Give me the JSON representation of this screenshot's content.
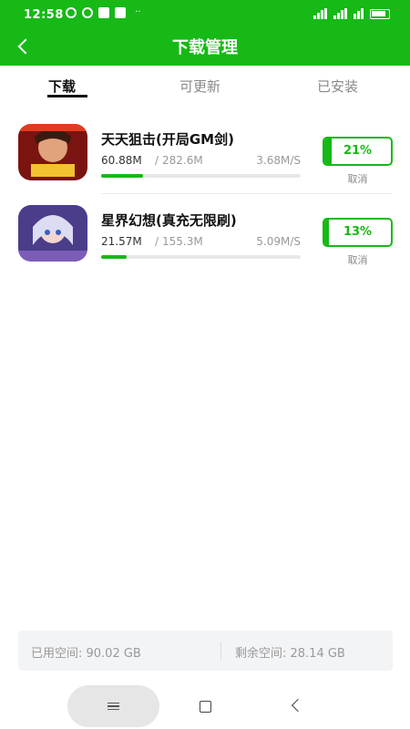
{
  "status": {
    "time": "12:58",
    "dots": "··"
  },
  "header": {
    "title": "下载管理",
    "back_icon": "chevron-left-icon"
  },
  "tabs": [
    {
      "label": "下载",
      "active": true
    },
    {
      "label": "可更新",
      "active": false
    },
    {
      "label": "已安装",
      "active": false
    }
  ],
  "downloads": [
    {
      "name": "天天狙击(开局GM剑)",
      "done": "60.88M",
      "separator": "/",
      "total": "282.6M",
      "speed": "3.68M/S",
      "percent_label": "21%",
      "progress": 0.21,
      "cancel": "取消",
      "icon": "game-icon"
    },
    {
      "name": "星界幻想(真充无限刷)",
      "done": "21.57M",
      "separator": "/",
      "total": "155.3M",
      "speed": "5.09M/S",
      "percent_label": "13%",
      "progress": 0.13,
      "cancel": "取消",
      "icon": "game-icon"
    }
  ],
  "storage": {
    "used": "已用空间: 90.02 GB",
    "free": "剩余空间: 28.14 GB"
  },
  "colors": {
    "accent": "#16b916"
  }
}
